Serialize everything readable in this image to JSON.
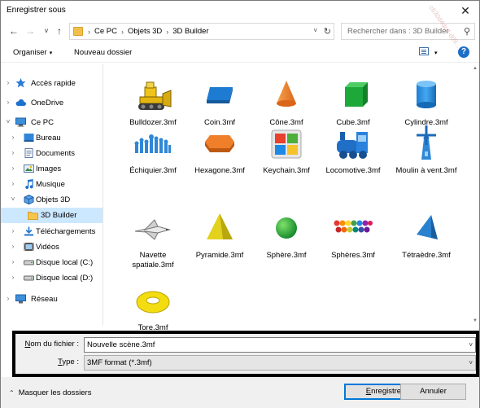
{
  "window": {
    "title": "Enregistrer sous",
    "close_glyph": "✕"
  },
  "address": {
    "back_glyph": "←",
    "forward_glyph": "→",
    "recent_glyph": "˅",
    "up_glyph": "↑",
    "crumbs": [
      "Ce PC",
      "Objets 3D",
      "3D Builder"
    ],
    "separator": "›",
    "refresh_glyph": "↻",
    "search_placeholder": "Rechercher dans : 3D Builder",
    "search_glyph": "⚲"
  },
  "toolbar": {
    "organize": "Organiser",
    "new_folder": "Nouveau dossier",
    "caret": "▾",
    "help": "?"
  },
  "nav": {
    "items": [
      {
        "label": "Accès rapide",
        "icon": "star-icon",
        "chevron": "›",
        "indent": 0
      },
      {
        "label": "OneDrive",
        "icon": "cloud-icon",
        "chevron": "›",
        "indent": 0
      },
      {
        "label": "Ce PC",
        "icon": "computer-icon",
        "chevron": "˅",
        "indent": 0
      },
      {
        "label": "Bureau",
        "icon": "desktop-icon",
        "chevron": "›",
        "indent": 1
      },
      {
        "label": "Documents",
        "icon": "documents-icon",
        "chevron": "›",
        "indent": 1
      },
      {
        "label": "Images",
        "icon": "images-icon",
        "chevron": "›",
        "indent": 1
      },
      {
        "label": "Musique",
        "icon": "music-icon",
        "chevron": "›",
        "indent": 1
      },
      {
        "label": "Objets 3D",
        "icon": "objects3d-icon",
        "chevron": "˅",
        "indent": 1
      },
      {
        "label": "3D Builder",
        "icon": "folder-icon",
        "chevron": "",
        "indent": 2,
        "selected": true
      },
      {
        "label": "Téléchargements",
        "icon": "downloads-icon",
        "chevron": "›",
        "indent": 1
      },
      {
        "label": "Vidéos",
        "icon": "videos-icon",
        "chevron": "›",
        "indent": 1
      },
      {
        "label": "Disque local (C:)",
        "icon": "drive-icon",
        "chevron": "›",
        "indent": 1
      },
      {
        "label": "Disque local (D:)",
        "icon": "drive-icon",
        "chevron": "›",
        "indent": 1
      },
      {
        "label": "Réseau",
        "icon": "network-icon",
        "chevron": "›",
        "indent": 0
      }
    ]
  },
  "files": [
    {
      "name": "Bulldozer.3mf",
      "icon": "bulldozer-icon"
    },
    {
      "name": "Coin.3mf",
      "icon": "coin-icon"
    },
    {
      "name": "Cône.3mf",
      "icon": "cone-icon"
    },
    {
      "name": "Cube.3mf",
      "icon": "cube-icon"
    },
    {
      "name": "Cylindre.3mf",
      "icon": "cylinder-icon"
    },
    {
      "name": "Échiquier.3mf",
      "icon": "chess-icon"
    },
    {
      "name": "Hexagone.3mf",
      "icon": "hexagon-icon"
    },
    {
      "name": "Keychain.3mf",
      "icon": "keychain-icon"
    },
    {
      "name": "Locomotive.3mf",
      "icon": "locomotive-icon"
    },
    {
      "name": "Moulin à vent.3mf",
      "icon": "windmill-icon"
    },
    {
      "name": "Navette spatiale.3mf",
      "icon": "shuttle-icon"
    },
    {
      "name": "Pyramide.3mf",
      "icon": "pyramid-icon"
    },
    {
      "name": "Sphère.3mf",
      "icon": "sphere-icon"
    },
    {
      "name": "Sphères.3mf",
      "icon": "spheres-icon"
    },
    {
      "name": "Tétraèdre.3mf",
      "icon": "tetrahedron-icon"
    },
    {
      "name": "Tore.3mf",
      "icon": "torus-icon"
    }
  ],
  "save_fields": {
    "filename_label_key": "N",
    "filename_label_rest": "om du fichier :",
    "filename_value": "Nouvelle scène.3mf",
    "type_label_key": "T",
    "type_label_rest": "ype :",
    "type_value": "3MF format (*.3mf)",
    "dropdown_glyph": "˅"
  },
  "footer": {
    "hide_folders": "Masquer les dossiers",
    "hide_caret": "⌃",
    "save_key": "E",
    "save_rest": "nregistrer",
    "cancel": "Annuler"
  },
  "watermark": "c630d4dcd-d09..."
}
